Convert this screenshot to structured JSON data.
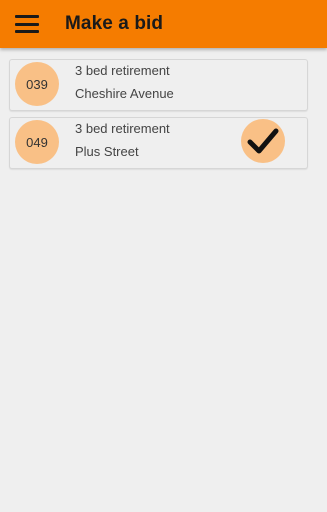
{
  "appbar": {
    "menu_icon": "hamburger-menu-icon",
    "title": "Make a bid",
    "color": "#f57c00"
  },
  "bids": [
    {
      "number": "039",
      "line1": "3 bed retirement",
      "line2": "Cheshire Avenue",
      "selected": false
    },
    {
      "number": "049",
      "line1": "3 bed retirement",
      "line2": "Plus Street",
      "selected": true,
      "selected_icon": "checkmark-icon"
    }
  ],
  "colors": {
    "badge": "#f9c086",
    "background": "#efefef"
  }
}
